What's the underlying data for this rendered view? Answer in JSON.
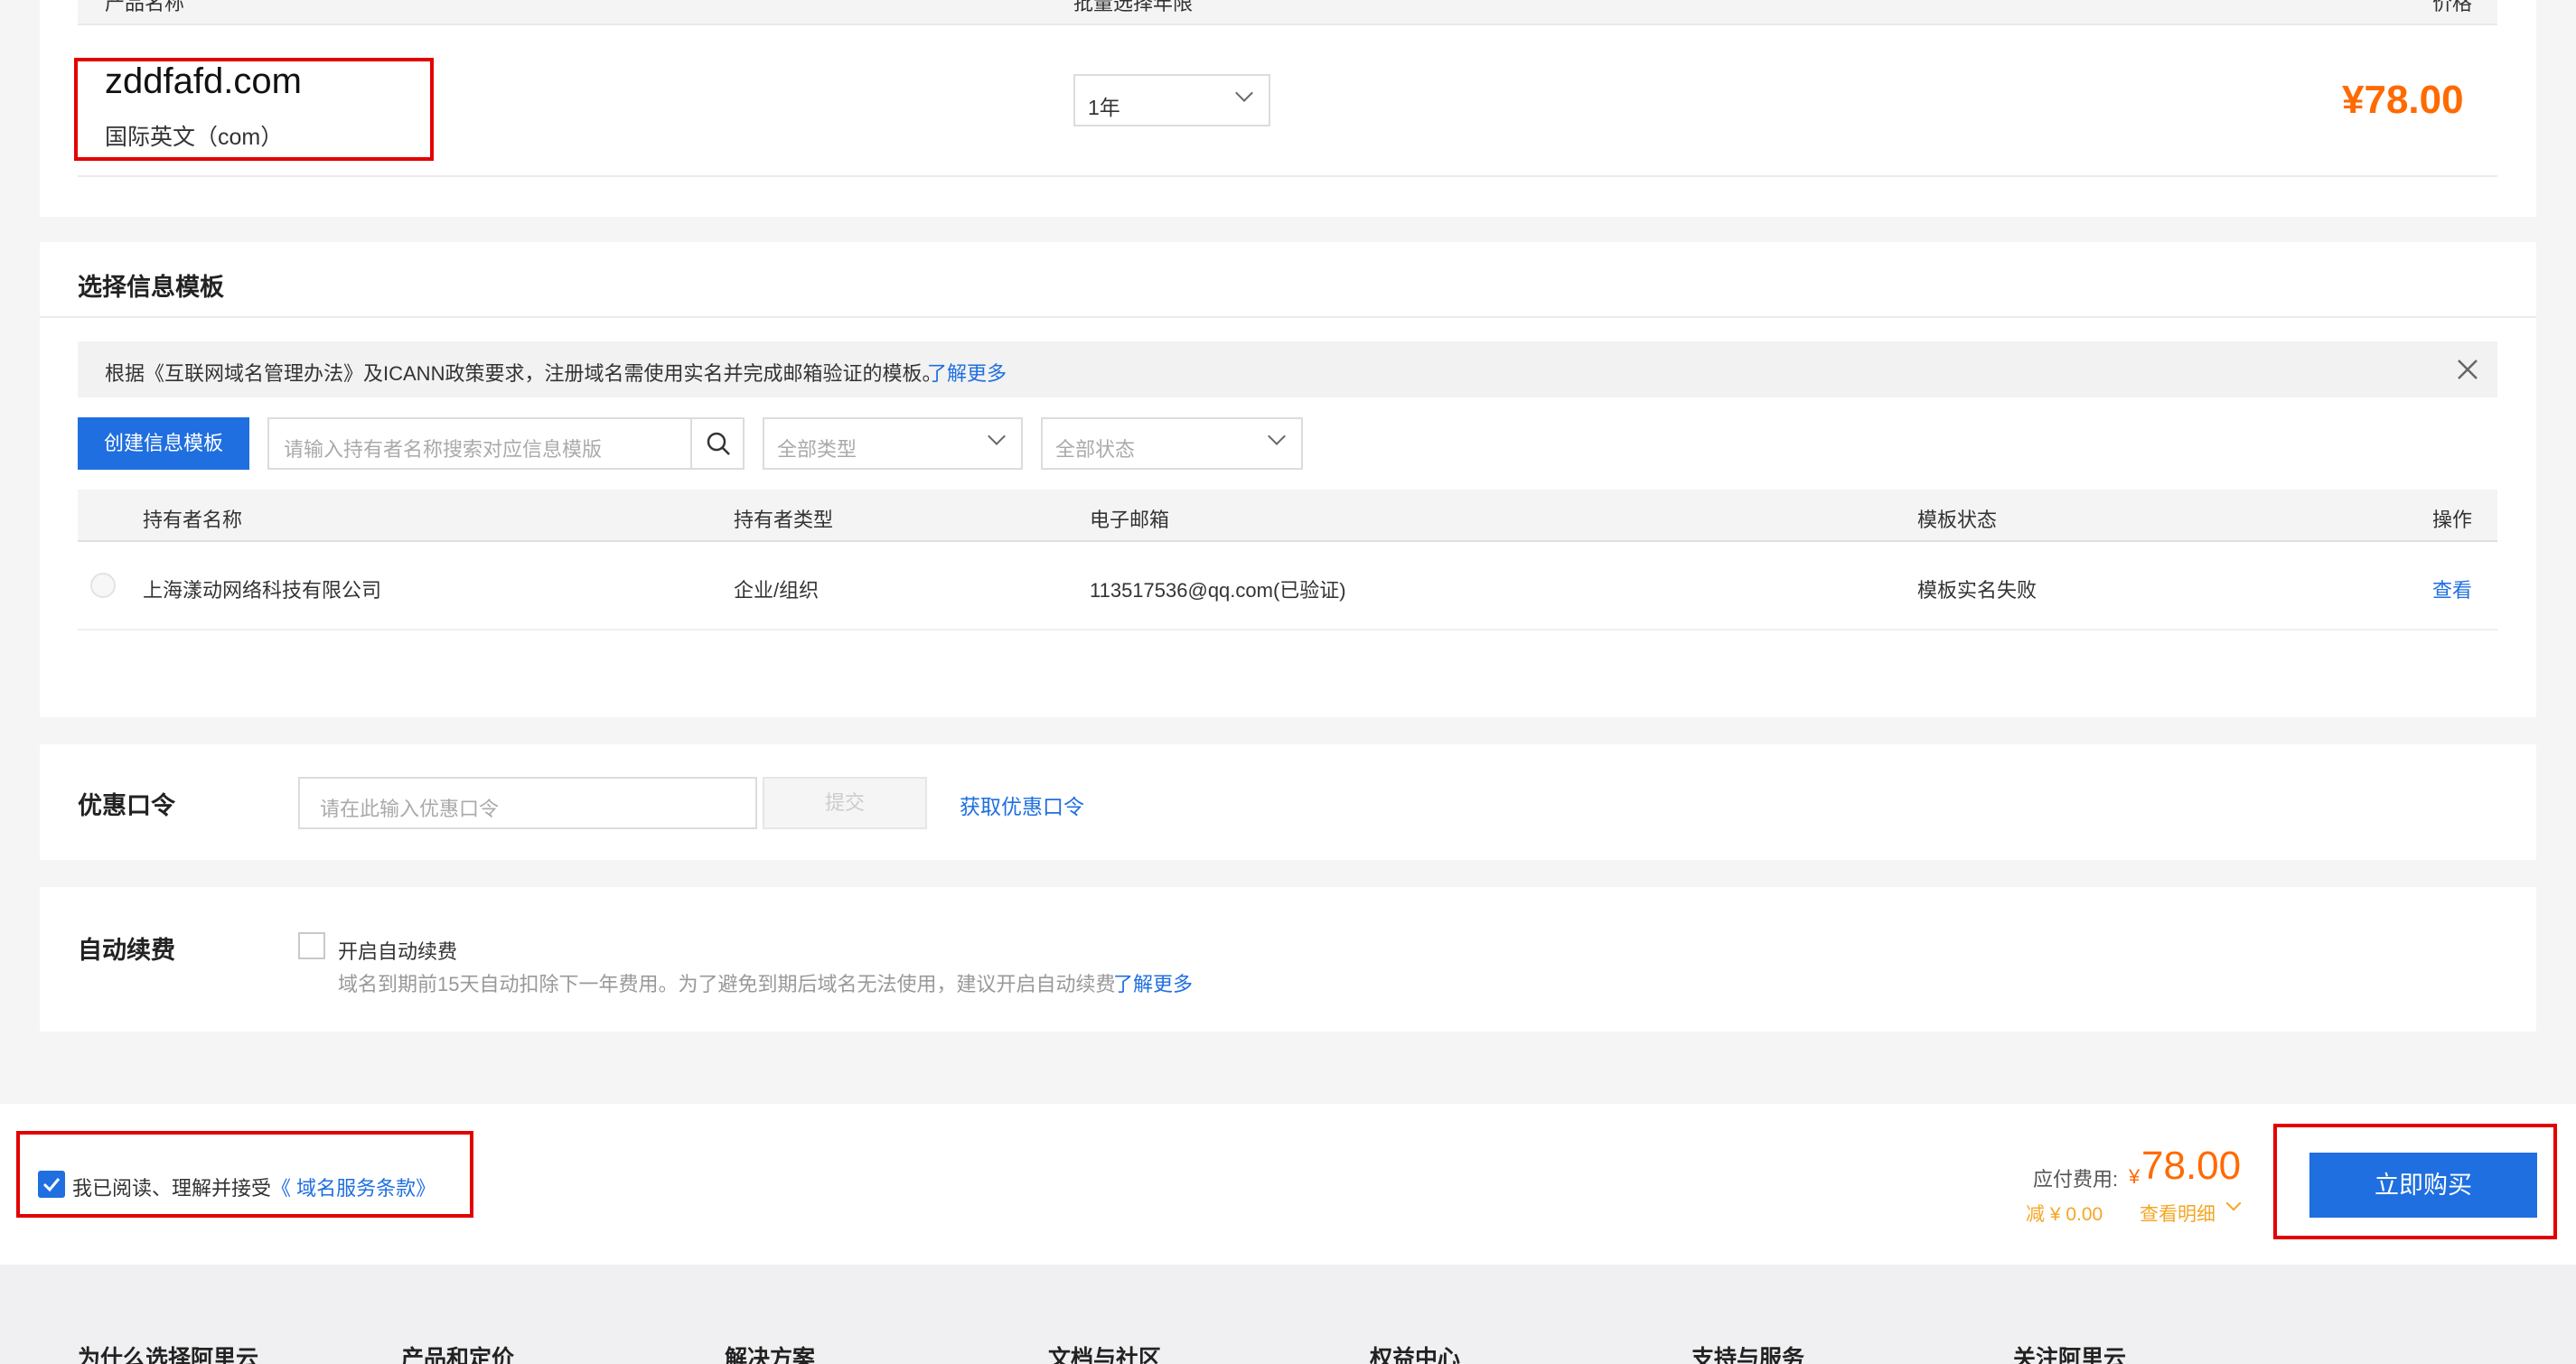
{
  "product_table": {
    "col_product": "产品名称",
    "col_period": "批量选择年限",
    "col_price": "价格",
    "domain": "zddfafd.com",
    "domain_type": "国际英文（com）",
    "period_value": "1年",
    "price": "¥78.00"
  },
  "template_section": {
    "title": "选择信息模板",
    "notice_text": "根据《互联网域名管理办法》及ICANN政策要求，注册域名需使用实名并完成邮箱验证的模板。",
    "notice_link": "了解更多",
    "create_button": "创建信息模板",
    "search_placeholder": "请输入持有者名称搜索对应信息模版",
    "type_filter": "全部类型",
    "status_filter": "全部状态",
    "columns": {
      "holder": "持有者名称",
      "holder_type": "持有者类型",
      "email": "电子邮箱",
      "status": "模板状态",
      "action": "操作"
    },
    "row": {
      "holder": "上海漾动网络科技有限公司",
      "holder_type": "企业/组织",
      "email": "113517536@qq.com(已验证)",
      "status": "模板实名失败",
      "action": "查看"
    }
  },
  "coupon": {
    "label": "优惠口令",
    "placeholder": "请在此输入优惠口令",
    "submit": "提交",
    "get_link": "获取优惠口令"
  },
  "auto_renew": {
    "label": "自动续费",
    "checkbox_label": "开启自动续费",
    "hint": "域名到期前15天自动扣除下一年费用。为了避免到期后域名无法使用，建议开启自动续费",
    "hint_link": "了解更多"
  },
  "footer_bar": {
    "agree_text": "我已阅读、理解并接受",
    "agree_link": "《 域名服务条款》",
    "fee_label": "应付费用:",
    "currency": "¥",
    "fee_amount": "78.00",
    "discount": "减 ¥ 0.00",
    "detail_link": "查看明细",
    "buy_button": "立即购买"
  },
  "site_footer": [
    "为什么选择阿里云",
    "产品和定价",
    "解决方案",
    "文档与社区",
    "权益中心",
    "支持与服务",
    "关注阿里云"
  ]
}
